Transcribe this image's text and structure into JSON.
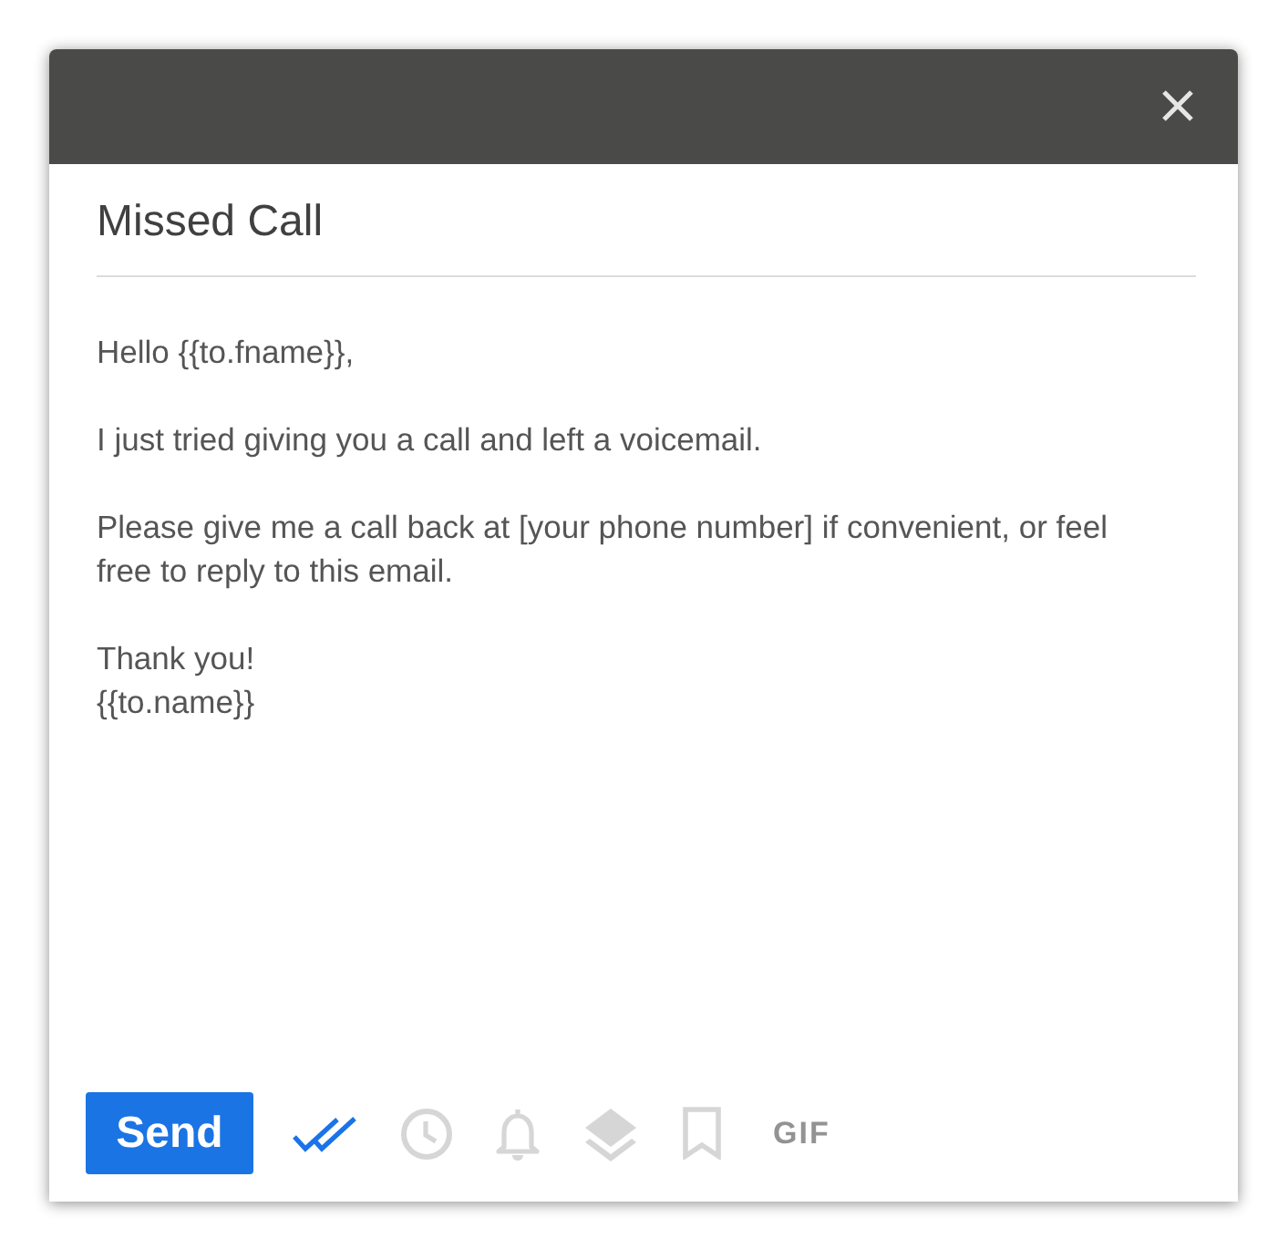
{
  "window": {
    "close_button": {
      "kind": "close"
    }
  },
  "subject": "Missed Call",
  "body": {
    "paragraphs": [
      "Hello {{to.fname}},",
      "I just tried giving you a call and left a voicemail.",
      "Please give me a call back at [your phone number] if convenient, or feel\nfree to reply to this email.",
      "Thank you!\n{{to.name}}"
    ]
  },
  "toolbar": {
    "send_button": "Send",
    "tools": [
      {
        "kind": "double-check",
        "on": true
      },
      {
        "kind": "clock",
        "on": false
      },
      {
        "kind": "bell",
        "on": false
      },
      {
        "kind": "layers",
        "on": false
      },
      {
        "kind": "bookmark",
        "on": false
      },
      {
        "kind": "gif",
        "label": "GIF",
        "on": false
      }
    ]
  }
}
